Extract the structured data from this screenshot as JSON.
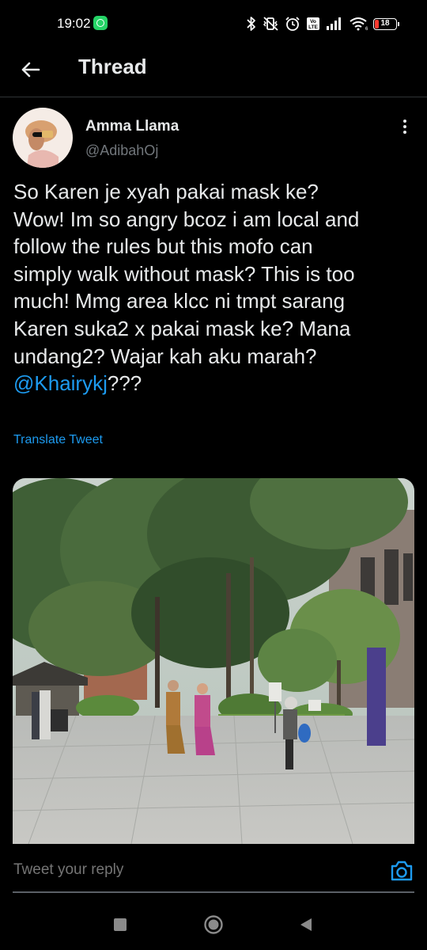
{
  "status_bar": {
    "time": "19:02",
    "battery": "18",
    "battery_level": 0.18,
    "icons": [
      "whatsapp-icon",
      "bluetooth-icon",
      "vibrate-icon",
      "alarm-icon",
      "volte-icon",
      "signal-icon",
      "wifi-icon",
      "battery-icon"
    ],
    "volte_label": "Vo LTE"
  },
  "header": {
    "title": "Thread",
    "back_icon": "arrow-left-icon"
  },
  "tweet": {
    "author_name": "Amma Llama",
    "author_handle": "@AdibahOj",
    "text_lines": [
      "So Karen je xyah pakai mask ke?",
      "Wow! Im so angry bcoz i am local and",
      "follow the rules but this mofo can",
      "simply walk without mask? This is too",
      "much! Mmg area klcc ni tmpt sarang",
      "Karen suka2 x pakai mask ke? Mana",
      "undang2? Wajar kah aku marah?"
    ],
    "mention": "@Khairykj",
    "mention_suffix": "???",
    "translate_label": "Translate Tweet",
    "more_icon": "more-vertical-icon"
  },
  "reply": {
    "placeholder": "Tweet your reply",
    "camera_icon": "camera-icon"
  },
  "colors": {
    "background": "#000000",
    "text": "#e7e9ea",
    "secondary_text": "#71767b",
    "accent": "#1d9bf0",
    "divider": "#2f3336"
  }
}
